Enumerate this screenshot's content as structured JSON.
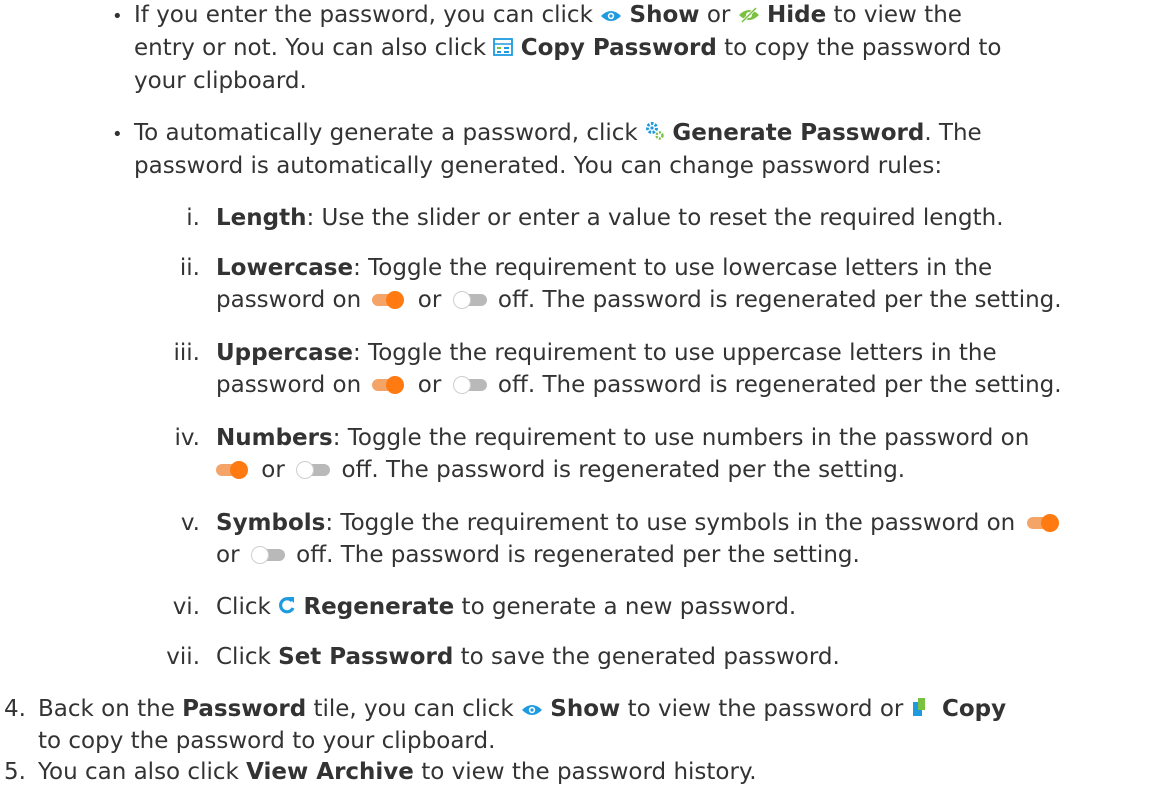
{
  "bullets": [
    "•",
    "•"
  ],
  "roman": [
    "i.",
    "ii.",
    "iii.",
    "iv.",
    "v.",
    "vi.",
    "vii."
  ],
  "steps": [
    "4.",
    "5."
  ],
  "p1": {
    "a": "If you enter the password, you can click ",
    "show": "Show",
    "b": " or ",
    "hide": "Hide",
    "c": " to view the",
    "d": "entry or not. You can also click ",
    "copy_password": "Copy Password",
    "e": " to copy the password to",
    "f": "your clipboard."
  },
  "p2": {
    "a": "To automatically generate a password, click ",
    "generate": "Generate Password",
    "b": ". The",
    "c": "password is automatically generated. You can change password rules:"
  },
  "rules": {
    "length_label": "Length",
    "length_text": ": Use the slider or enter a value to reset the required length.",
    "lower_label": "Lowercase",
    "lower_text": ": Toggle the requirement to use lowercase letters in the",
    "upper_label": "Uppercase",
    "upper_text": ": Toggle the requirement to use uppercase letters in the",
    "pw_on": "password on ",
    "or": " or ",
    "off_regen": " off. The password is regenerated per the setting.",
    "numbers_label": "Numbers",
    "numbers_text": ": Toggle the requirement to use numbers in the password on",
    "symbols_label": "Symbols",
    "symbols_text": ": Toggle the requirement to use symbols in the password on ",
    "or_start": "or ",
    "regen_click": "Click ",
    "regenerate": "Regenerate",
    "regen_text": " to generate a new password.",
    "set_click": "Click ",
    "set_password": "Set Password",
    "set_text": " to save the generated password."
  },
  "step4": {
    "a": "Back on the ",
    "password": "Password",
    "b": " tile, you can click ",
    "show": "Show",
    "c": " to view the password or ",
    "copy": "Copy",
    "d": "to copy the password to your clipboard."
  },
  "step5": {
    "a": "You can also click ",
    "view_archive": "View Archive",
    "b": " to view the password history."
  },
  "colors": {
    "toggle_on": "#ff7a10",
    "icon_blue": "#1e9be0",
    "icon_green": "#7ac142",
    "text": "#333333"
  },
  "icons": [
    "eye-icon",
    "eye-slash-icon",
    "copy-password-icon",
    "generate-password-icon",
    "toggle-on-icon",
    "toggle-off-icon",
    "regenerate-icon",
    "copy-icon"
  ]
}
